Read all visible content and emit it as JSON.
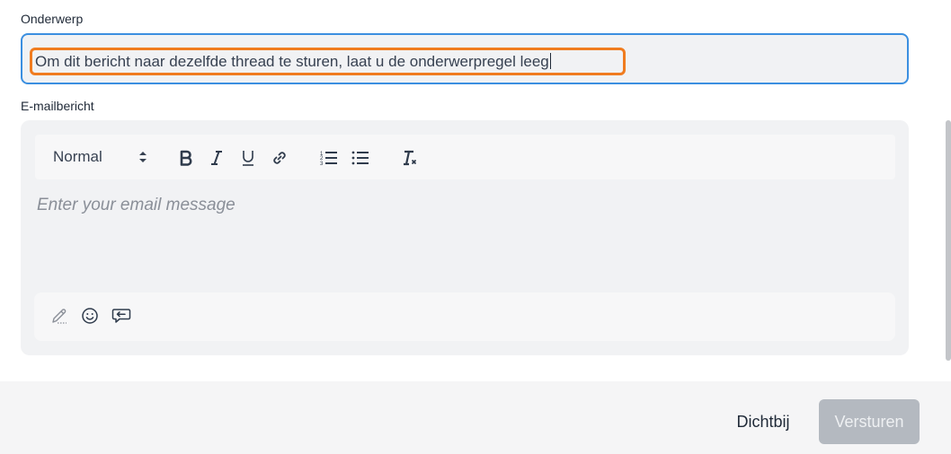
{
  "subject": {
    "label": "Onderwerp",
    "value": "Om dit bericht naar dezelfde thread te sturen, laat u de onderwerpregel leeg"
  },
  "message": {
    "label": "E-mailbericht",
    "placeholder": "Enter your email message",
    "format_selected": "Normal",
    "toolbar_icons": [
      "bold-icon",
      "italic-icon",
      "underline-icon",
      "link-icon",
      "ordered-list-icon",
      "bullet-list-icon",
      "clear-format-icon"
    ],
    "bottom_icons": [
      "signature-pen-icon",
      "emoji-icon",
      "canned-response-icon"
    ]
  },
  "footer": {
    "close_label": "Dichtbij",
    "send_label": "Versturen"
  },
  "colors": {
    "focus_border": "#3b8fe0",
    "highlight": "#f07c1f",
    "disabled_button": "#b4b9c0"
  }
}
